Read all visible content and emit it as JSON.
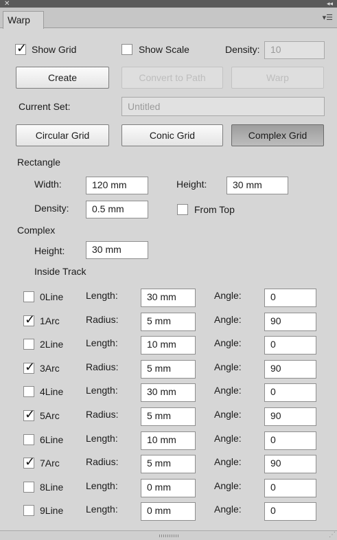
{
  "panel": {
    "close_glyph": "✕",
    "collapse_glyph": "◂◂",
    "tab_label": "Warp",
    "menu_icon": "panel-menu-icon"
  },
  "top": {
    "show_grid": {
      "label": "Show Grid",
      "checked": true
    },
    "show_scale": {
      "label": "Show Scale",
      "checked": false
    },
    "density_label": "Density:",
    "density_value": "10"
  },
  "buttons": {
    "create": "Create",
    "convert": "Convert to Path",
    "warp": "Warp"
  },
  "current_set": {
    "label": "Current Set:",
    "value": "Untitled"
  },
  "grid_buttons": {
    "circular": "Circular Grid",
    "conic": "Conic Grid",
    "complex": "Complex Grid"
  },
  "rectangle": {
    "section": "Rectangle",
    "width_label": "Width:",
    "width_value": "120 mm",
    "height_label": "Height:",
    "height_value": "30 mm",
    "density_label": "Density:",
    "density_value": "0.5 mm",
    "from_top": "From Top"
  },
  "complex": {
    "section": "Complex",
    "height_label": "Height:",
    "height_value": "30 mm",
    "inside_track": "Inside Track"
  },
  "track_rows": [
    {
      "name": "0Line",
      "checked": false,
      "param": "Length:",
      "value": "30 mm",
      "angle_label": "Angle:",
      "angle": "0"
    },
    {
      "name": "1Arc",
      "checked": true,
      "param": "Radius:",
      "value": "5 mm",
      "angle_label": "Angle:",
      "angle": "90"
    },
    {
      "name": "2Line",
      "checked": false,
      "param": "Length:",
      "value": "10 mm",
      "angle_label": "Angle:",
      "angle": "0"
    },
    {
      "name": "3Arc",
      "checked": true,
      "param": "Radius:",
      "value": "5 mm",
      "angle_label": "Angle:",
      "angle": "90"
    },
    {
      "name": "4Line",
      "checked": false,
      "param": "Length:",
      "value": "30 mm",
      "angle_label": "Angle:",
      "angle": "0"
    },
    {
      "name": "5Arc",
      "checked": true,
      "param": "Radius:",
      "value": "5 mm",
      "angle_label": "Angle:",
      "angle": "90"
    },
    {
      "name": "6Line",
      "checked": false,
      "param": "Length:",
      "value": "10 mm",
      "angle_label": "Angle:",
      "angle": "0"
    },
    {
      "name": "7Arc",
      "checked": true,
      "param": "Radius:",
      "value": "5 mm",
      "angle_label": "Angle:",
      "angle": "90"
    },
    {
      "name": "8Line",
      "checked": false,
      "param": "Length:",
      "value": "0 mm",
      "angle_label": "Angle:",
      "angle": "0"
    },
    {
      "name": "9Line",
      "checked": false,
      "param": "Length:",
      "value": "0 mm",
      "angle_label": "Angle:",
      "angle": "0"
    }
  ]
}
